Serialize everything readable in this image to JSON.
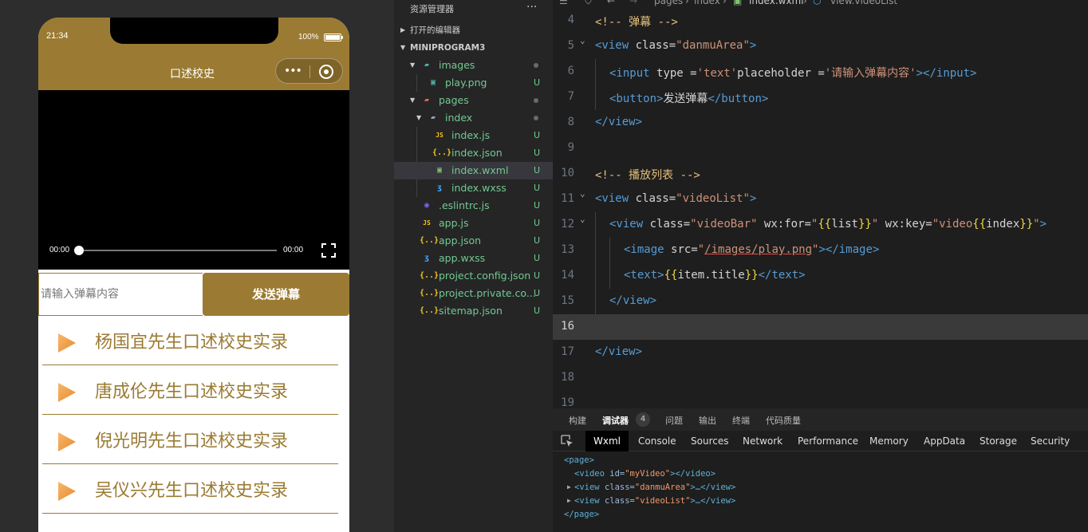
{
  "simulator": {
    "status_time": "21:34",
    "battery_pct": "100%",
    "nav_title": "口述校史",
    "capsule_dots": "•••",
    "video": {
      "time_current": "00:00",
      "time_total": "00:00",
      "progress": 0
    },
    "danmu": {
      "placeholder": "请输入弹幕内容",
      "send_label": "发送弹幕"
    },
    "list": [
      {
        "title": "杨国宜先生口述校史实录"
      },
      {
        "title": "唐成伦先生口述校史实录"
      },
      {
        "title": "倪光明先生口述校史实录"
      },
      {
        "title": "吴仪兴先生口述校史实录"
      }
    ]
  },
  "explorer": {
    "header": "资源管理器",
    "more": "···",
    "open_editors": "打开的编辑器",
    "project": "MINIPROGRAM3",
    "tree": [
      {
        "name": "images",
        "status": "",
        "icon": "folder-images-icon"
      },
      {
        "name": "play.png",
        "status": "U",
        "icon": "image-file-icon"
      },
      {
        "name": "pages",
        "status": "",
        "icon": "folder-pages-icon"
      },
      {
        "name": "index",
        "status": "",
        "icon": "folder-icon"
      },
      {
        "name": "index.js",
        "status": "U",
        "icon": "js-file-icon"
      },
      {
        "name": "index.json",
        "status": "U",
        "icon": "json-file-icon"
      },
      {
        "name": "index.wxml",
        "status": "U",
        "icon": "wxml-file-icon"
      },
      {
        "name": "index.wxss",
        "status": "U",
        "icon": "wxss-file-icon"
      },
      {
        "name": ".eslintrc.js",
        "status": "U",
        "icon": "eslint-file-icon"
      },
      {
        "name": "app.js",
        "status": "U",
        "icon": "js-file-icon"
      },
      {
        "name": "app.json",
        "status": "U",
        "icon": "json-file-icon"
      },
      {
        "name": "app.wxss",
        "status": "U",
        "icon": "wxss-file-icon"
      },
      {
        "name": "project.config.json",
        "status": "U",
        "icon": "json-file-icon"
      },
      {
        "name": "project.private.co...",
        "status": "U",
        "icon": "json-file-icon"
      },
      {
        "name": "sitemap.json",
        "status": "U",
        "icon": "json-file-icon"
      }
    ]
  },
  "editor": {
    "breadcrumb": [
      "pages",
      "index",
      "index.wxml",
      "view.videoList"
    ],
    "lines": [
      {
        "n": "4",
        "text": "<!-- 弹幕 -->"
      },
      {
        "n": "5",
        "text": "<view class=\"danmuArea\">"
      },
      {
        "n": "6",
        "text": "<input type ='text'placeholder ='请输入弹幕内容'></input>"
      },
      {
        "n": "7",
        "text": "<button>发送弹幕</button>"
      },
      {
        "n": "8",
        "text": "</view>"
      },
      {
        "n": "9",
        "text": ""
      },
      {
        "n": "10",
        "text": "<!-- 播放列表 -->"
      },
      {
        "n": "11",
        "text": "<view class=\"videoList\">"
      },
      {
        "n": "12",
        "text": "<view class=\"videoBar\" wx:for=\"{{list}}\" wx:key=\"video{{index}}\">"
      },
      {
        "n": "13",
        "text": "<image src=\"/images/play.png\"></image>"
      },
      {
        "n": "14",
        "text": "<text>{{item.title}}</text>"
      },
      {
        "n": "15",
        "text": "</view>"
      },
      {
        "n": "16",
        "text": ""
      },
      {
        "n": "17",
        "text": "</view>"
      },
      {
        "n": "18",
        "text": ""
      },
      {
        "n": "19",
        "text": ""
      }
    ]
  },
  "debug": {
    "tabs": [
      "构建",
      "调试器",
      "问题",
      "输出",
      "终端",
      "代码质量"
    ],
    "badge": "4",
    "devtools_tabs": [
      "Wxml",
      "Console",
      "Sources",
      "Network",
      "Performance",
      "Memory",
      "AppData",
      "Storage",
      "Security"
    ],
    "dom": [
      "<page>",
      "<video id=\"myVideo\"></video>",
      "<view class=\"danmuArea\">…</view>",
      "<view class=\"videoList\">…</view>",
      "</page>"
    ]
  },
  "colors": {
    "brand": "#9b7b33",
    "tree_green": "#73c991",
    "editor_bg": "#1e1e1e"
  }
}
